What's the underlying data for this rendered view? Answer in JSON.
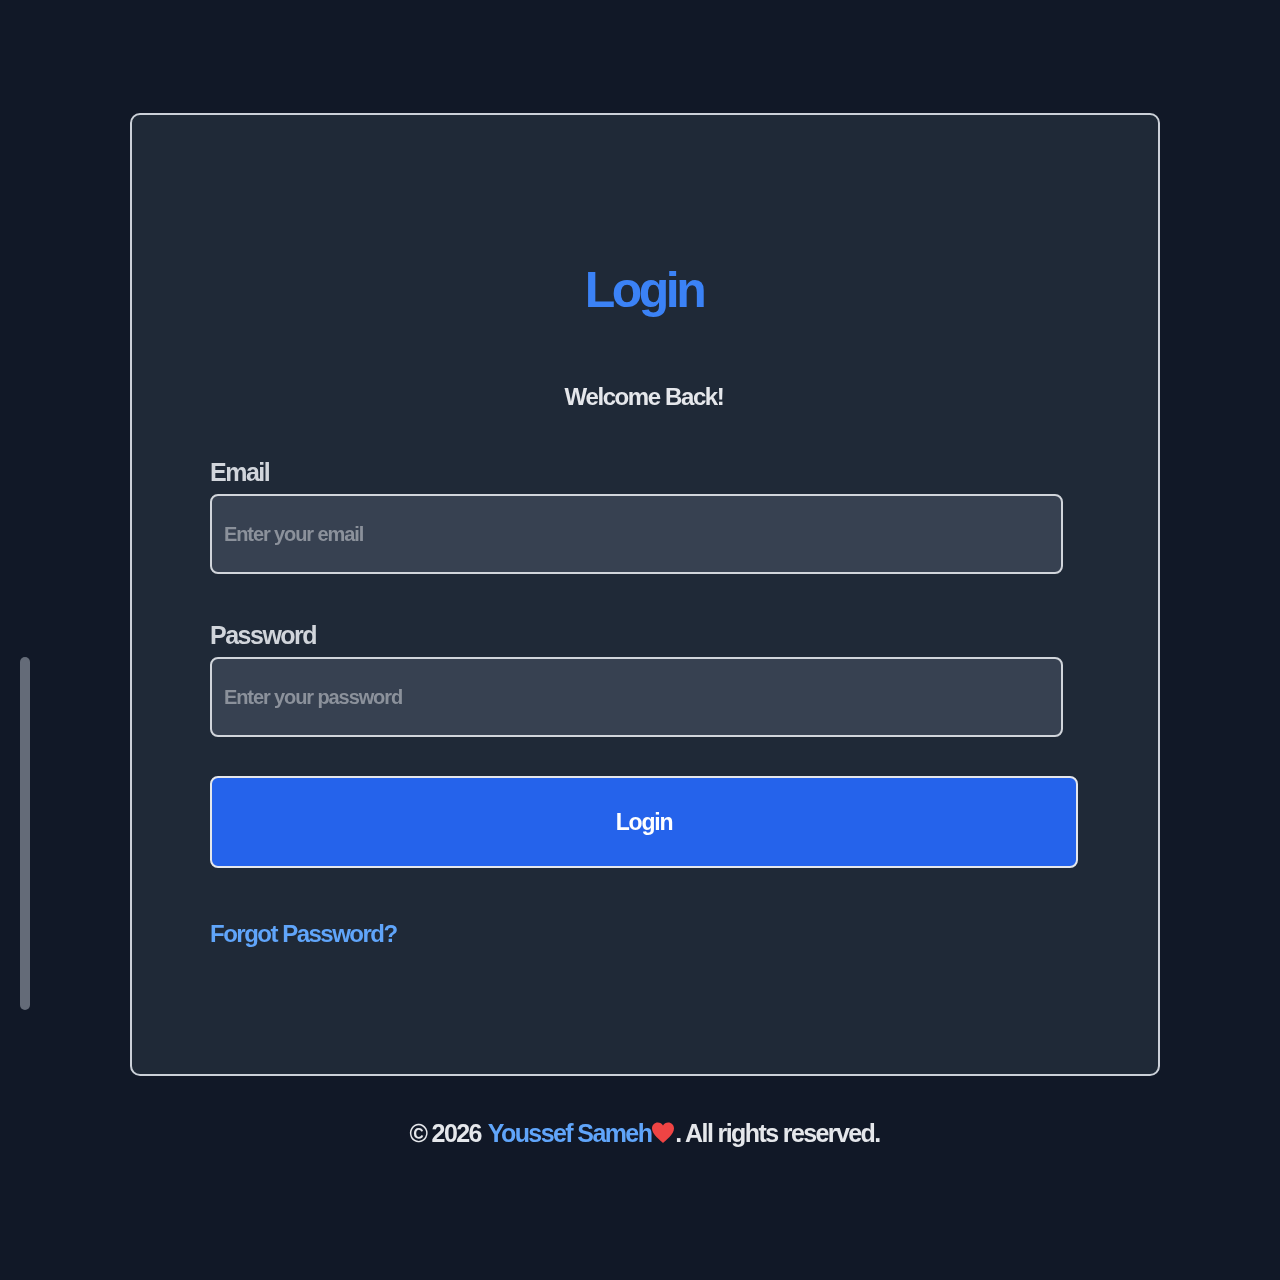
{
  "card": {
    "title": "Login",
    "subtitle": "Welcome Back!",
    "fields": [
      {
        "label": "Email",
        "placeholder": "Enter your email"
      },
      {
        "label": "Password",
        "placeholder": "Enter your password"
      }
    ],
    "submit_button": "Login",
    "forgot_link": "Forgot Password?"
  },
  "footer": {
    "copyright": "© 2026",
    "author": "Youssef Sameh",
    "rights": ". All rights reserved."
  }
}
